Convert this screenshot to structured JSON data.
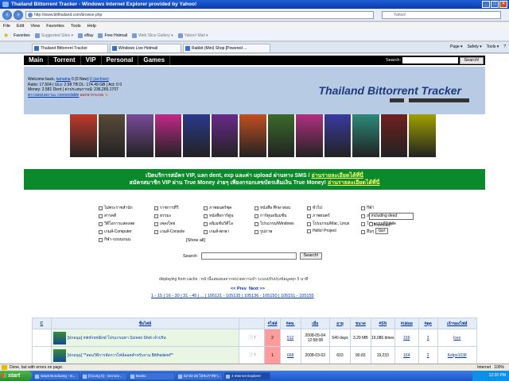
{
  "window": {
    "title": "Thailand Bittorrent Tracker - Windows Internet Explorer provided by Yahoo!",
    "address": "http://www.bitthailand.com/browse.php",
    "search_placeholder": "Yahoo!"
  },
  "menu": [
    "File",
    "Edit",
    "View",
    "Favorites",
    "Tools",
    "Help"
  ],
  "favorites": {
    "label": "Favorites",
    "items": [
      "Suggested Sites ▾",
      "eBay",
      "Free Hotmail",
      "Web Slice Gallery ▾",
      "Yahoo! Mail ▾"
    ]
  },
  "tabs": [
    "Thailand Bittorrent Tracker",
    "Windows Live Hotmail",
    "Rabbit (Mini) Shop [Powered ..."
  ],
  "commands": [
    "Page ▾",
    "Safety ▾",
    "Tools ▾",
    "?"
  ],
  "site_nav": {
    "items": [
      "Main",
      "Torrent",
      "VIP",
      "Personal",
      "Games"
    ],
    "search_label": "Search:",
    "search_button": "Search!"
  },
  "user": {
    "welcome": "Welcome back,",
    "name": "tamatna",
    "inbox": "0 (0 New)",
    "archive": "0 (archive)",
    "ratio": "Ratio: 17.504 | ULs: 2.98 TB DL: 174.49 GB | Act: 0 0",
    "money": "Money: 2,581 Dent | ค่าประสบการณ์: 236,265.1707",
    "status": "ตรวจสอบสถานะ connectable",
    "logout": "ออกจากระบบ"
  },
  "logo": "Thailand Bittorrent Tracker",
  "banner_colors": [
    "#c0392b",
    "#5a4a3a",
    "#7a4a9a",
    "#c02888",
    "#2a3a8a",
    "#6a2a8a",
    "#c05020",
    "#3a6a2a",
    "#b03080",
    "#3a3aa0",
    "#2a8a7a",
    "#702020",
    "#a0a000"
  ],
  "promo": {
    "line1": "เปิดบริการสมัคร VIP, แลก dent, exp และค่า upload ผ่านทาง SMS /",
    "line1_link": "อ่านรายละเอียดได้ที่นี่",
    "line2": "สมัครสมาชิก VIP ผ่าน True Money ง่ายๆ เพียงกรอกเลขบัตรเติมเงิน True Money!",
    "line2_link": "อ่านรายละเอียดได้ที่นี่"
  },
  "categories": [
    [
      "ไม่พระราชสำนัก",
      "ราชการที่วี",
      "ภาพยนตร์ชุด",
      "หนังสือ ศึกษาสอบ",
      "ทั่วไป",
      "กีฬา"
    ],
    [
      "สารคดี",
      "ธรรมะ",
      "หนังสือการ์ตูน",
      "การ์ตูนอนิเมชั่น",
      "ภาพยนตร์",
      "ภาพยนตร์ DVD"
    ],
    [
      "วีดีโอการแสดงสด",
      "เพลงไทย",
      "อนิเมชั่นวิดีโอ",
      "โปรแกรม/Windows",
      "โปรแกรม/Mac, Linux",
      "โปรแกรม/Mobile"
    ],
    [
      "เกมส์-Computer",
      "เกมส์-Console",
      "เกมส์-พกพา",
      "รูปภาพ",
      "Hello! Project",
      "อื่นๆ"
    ],
    [
      "กีฬา-รถบนถนน"
    ]
  ],
  "show_all": "[Show all]",
  "dead_select": "including dead",
  "freeload": "Freeload?",
  "go": "Go!",
  "search": {
    "label": "Search:",
    "button": "Search!"
  },
  "cache_text": "displaying from cache : หน้านี้แสดงผลจากหน่วยความจำ ระบบปรับปรุงข้อมูลทุก 5 นาที",
  "pager": {
    "prev": "<< Prev",
    "next": "Next >>",
    "pages": "1 - 15 | 16 - 30 | 31 - 45 | ... | 105121 - 105135 | 105136 - 105150 | 105151 - 105155"
  },
  "table": {
    "headers": [
      "C",
      "ชื่อไฟล์",
      "",
      "#ไฟล์",
      "#คห.",
      "เมื่อ",
      "อายุ",
      "ขนาด",
      "#SN",
      "#ปล่อย",
      "#ดูด",
      "เจ้าของไฟล์"
    ],
    "rows": [
      [
        "",
        "[ปกอนุม] mtnFrontEnd โปรแกรมทา Screen Shot เจ้าบริด",
        "",
        "2",
        "512",
        "2008-05-04 12:58:08",
        "540 days",
        "3.29 MB",
        "19,086 times",
        "156",
        "3",
        "lcez"
      ],
      [
        "",
        "[ปกอนุม] **สอนวิธีการจัดการไฟล์ลอตสำหรับงาน Bitthailand**",
        "",
        "1",
        "668",
        "2008-03-02",
        "603",
        "90.83",
        "19,233",
        "164",
        "2",
        "Kelpo1038"
      ]
    ]
  },
  "status": {
    "text": "Done, but with errors on page.",
    "zone": "Internet",
    "zoom": "100%"
  },
  "taskbar": {
    "start": "start",
    "items": [
      "Siwat Bunduang - In...",
      "[Goong 5] - na-mov...",
      "Book1",
      "52-02-26 โลหะการตา...",
      "4 Internet Explorer"
    ],
    "clock": "12:30 PM"
  }
}
